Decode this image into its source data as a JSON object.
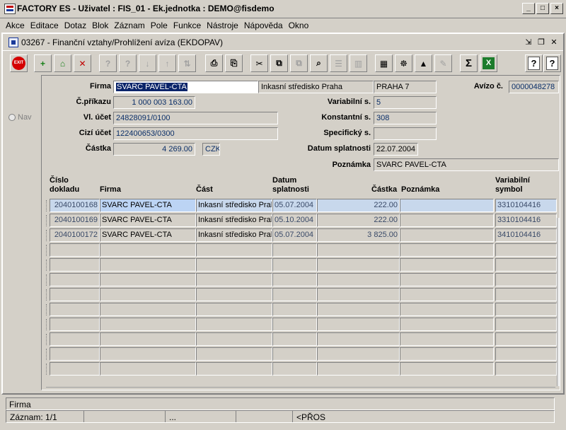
{
  "window": {
    "title": "FACTORY ES - Uživatel : FIS_01 - Ek.jednotka : DEMO@fisdemo"
  },
  "menu": [
    "Akce",
    "Editace",
    "Dotaz",
    "Blok",
    "Záznam",
    "Pole",
    "Funkce",
    "Nástroje",
    "Nápověda",
    "Okno"
  ],
  "form": {
    "title": "03267 - Finanční vztahy/Prohlížení avíza (EKDOPAV)"
  },
  "toolbar": {
    "exit_label": "EXIT",
    "sigma": "Σ",
    "excel": "X",
    "help": "?"
  },
  "nav": {
    "label": "Nav"
  },
  "header": {
    "firma_label": "Firma",
    "firma_value": "SVARC PAVEL-CTA",
    "stredisko_value": "Inkasní středisko Praha",
    "mesto_value": "PRAHA 7",
    "avizo_label": "Avízo č.",
    "avizo_value": "0000048278",
    "prikaz_label": "Č.příkazu",
    "prikaz_value": "1 000 003 163.00",
    "variabilni_label": "Variabilní s.",
    "variabilni_value": "5",
    "vl_ucet_label": "Vl. účet",
    "vl_ucet_value": "24828091/0100",
    "konstantni_label": "Konstantní s.",
    "konstantni_value": "308",
    "cizi_ucet_label": "Cizí účet",
    "cizi_ucet_value": "122400653/0300",
    "specificky_label": "Specifický s.",
    "specificky_value": "",
    "castka_label": "Částka",
    "castka_value": "4 269.00",
    "mena_value": "CZK",
    "splatnost_label": "Datum splatnosti",
    "splatnost_value": "22.07.2004",
    "poznamka_label": "Poznámka",
    "poznamka_value": "SVARC PAVEL-CTA"
  },
  "table": {
    "columns": {
      "cislo_1": "Číslo",
      "cislo_2": "dokladu",
      "firma": "Firma",
      "cast": "Část",
      "datum_1": "Datum",
      "datum_2": "splatnosti",
      "castka": "Částka",
      "poznamka": "Poznámka",
      "varsym_1": "Variabilní",
      "varsym_2": "symbol"
    },
    "rows": [
      {
        "doklad": "2040100168",
        "firma": "SVARC PAVEL-CTA",
        "cast": "Inkasní středisko Prah",
        "datum": "05.07.2004",
        "castka": "222.00",
        "poznamka": "",
        "varsym": "3310104416"
      },
      {
        "doklad": "2040100169",
        "firma": "SVARC PAVEL-CTA",
        "cast": "Inkasní středisko Prah",
        "datum": "05.10.2004",
        "castka": "222.00",
        "poznamka": "",
        "varsym": "3310104416"
      },
      {
        "doklad": "2040100172",
        "firma": "SVARC PAVEL-CTA",
        "cast": "Inkasní středisko Prah",
        "datum": "05.07.2004",
        "castka": "3 825.00",
        "poznamka": "",
        "varsym": "3410104416"
      }
    ]
  },
  "status": {
    "field": "Firma",
    "record": "Záznam: 1/1",
    "ellipsis": "...",
    "mode": "<PŘOS"
  }
}
